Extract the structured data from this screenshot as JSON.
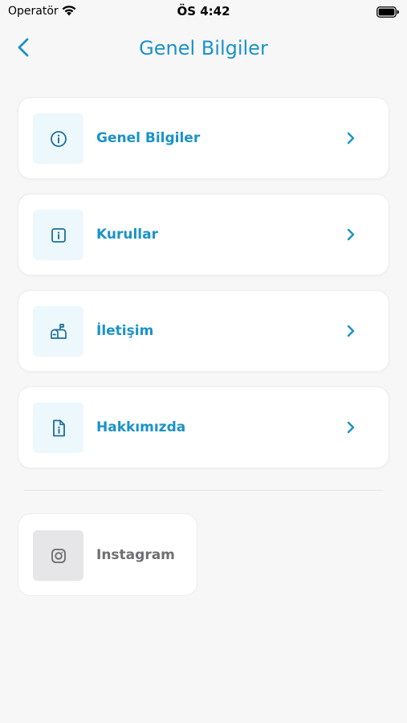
{
  "status_bar": {
    "carrier": "Operatör",
    "time": "ÖS 4:42"
  },
  "nav": {
    "title": "Genel Bilgiler"
  },
  "menu": {
    "items": [
      {
        "label": "Genel Bilgiler",
        "icon": "info-circle-icon"
      },
      {
        "label": "Kurullar",
        "icon": "info-square-icon"
      },
      {
        "label": "İletişim",
        "icon": "mailbox-icon"
      },
      {
        "label": "Hakkımızda",
        "icon": "info-document-icon"
      }
    ]
  },
  "social": {
    "instagram_label": "Instagram",
    "icon": "instagram-icon"
  },
  "colors": {
    "accent": "#1a93c7",
    "icon_bg": "#edf8fd",
    "background": "#f7f7f8"
  }
}
